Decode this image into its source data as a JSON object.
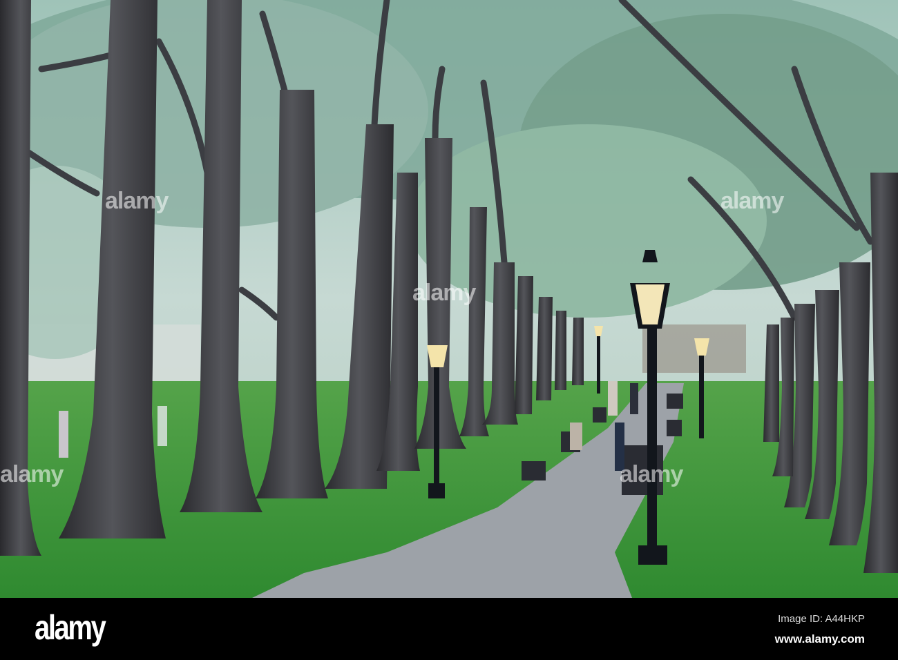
{
  "footer": {
    "logo": "alamy",
    "image_id": "Image ID: A44HKP",
    "url": "www.alamy.com"
  },
  "watermark": "alamy",
  "colors": {
    "grass": "#3f9a3a",
    "sky": "#c9dcd6",
    "trunk": "#3b3a3d",
    "path": "#9ea3aa"
  }
}
